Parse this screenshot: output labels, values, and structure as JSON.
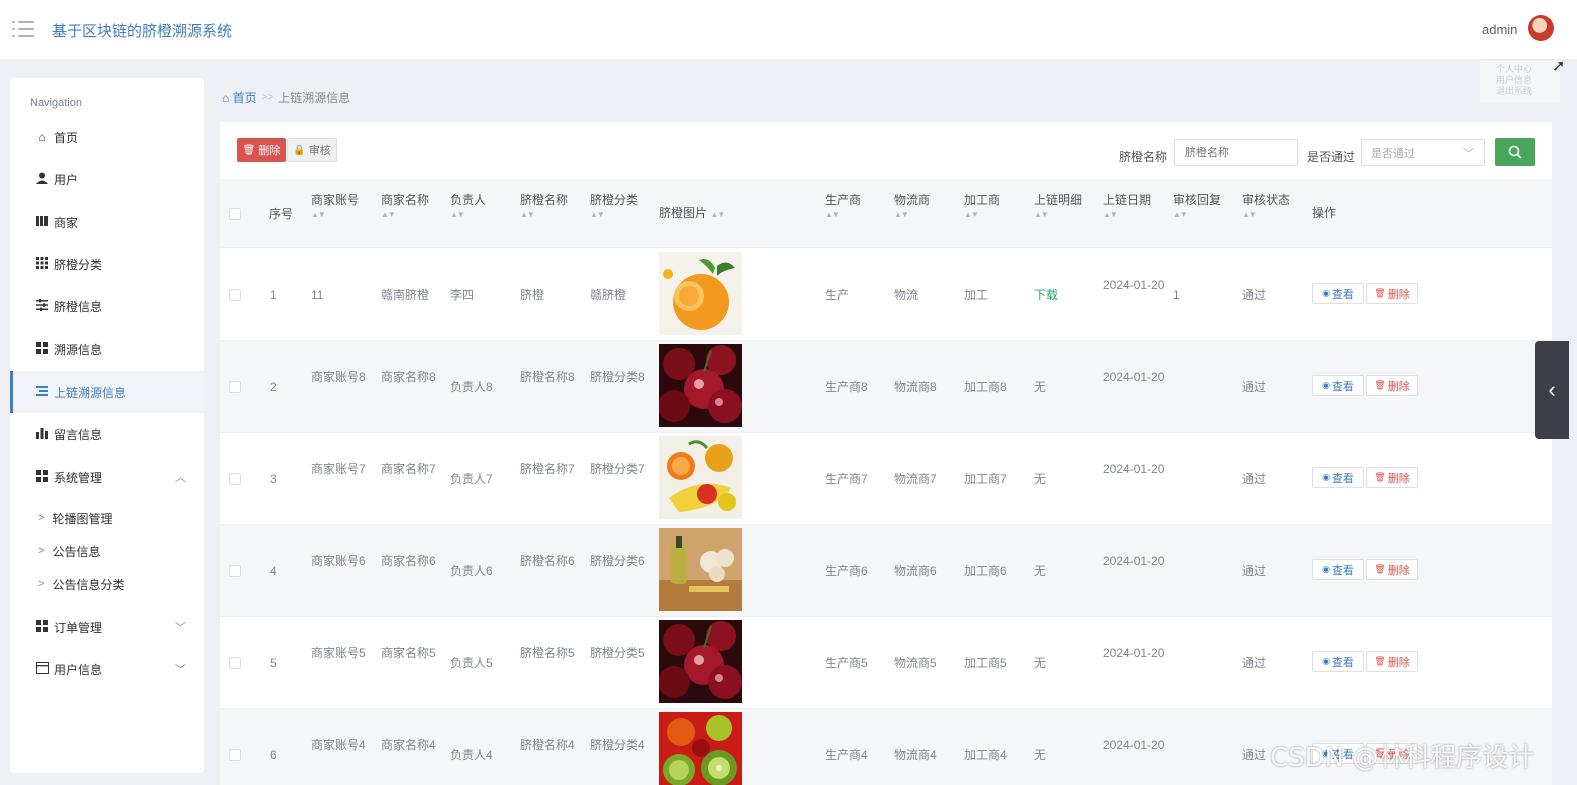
{
  "app": {
    "title": "基于区块链的脐橙溯源系统",
    "user": "admin",
    "ghost_menu": [
      "个人中心",
      "用户信息",
      "退出系统"
    ]
  },
  "sidebar": {
    "caption": "Navigation",
    "items": [
      {
        "label": "首页",
        "icon": "home-icon"
      },
      {
        "label": "用户",
        "icon": "user-icon"
      },
      {
        "label": "商家",
        "icon": "book-icon"
      },
      {
        "label": "脐橙分类",
        "icon": "grid-icon"
      },
      {
        "label": "脐橙信息",
        "icon": "sliders-icon"
      },
      {
        "label": "溯源信息",
        "icon": "tiles-icon"
      },
      {
        "label": "上链溯源信息",
        "icon": "list-icon",
        "active": true
      },
      {
        "label": "留言信息",
        "icon": "bar-chart-icon"
      },
      {
        "label": "系统管理",
        "icon": "tiles-icon",
        "expanded": true
      },
      {
        "label": "订单管理",
        "icon": "tiles-icon"
      },
      {
        "label": "用户信息",
        "icon": "card-icon"
      }
    ],
    "system_sub": [
      "轮播图管理",
      "公告信息",
      "公告信息分类"
    ]
  },
  "breadcrumb": {
    "home": "首页",
    "sep": ">>",
    "current": "上链溯源信息"
  },
  "toolbar": {
    "delete_label": "删除",
    "audit_label": "审核",
    "name_label": "脐橙名称",
    "name_placeholder": "脐橙名称",
    "pass_label": "是否通过",
    "pass_placeholder": "是否通过"
  },
  "table": {
    "headers": [
      "序号",
      "商家账号",
      "商家名称",
      "负责人",
      "脐橙名称",
      "脐橙分类",
      "脐橙图片",
      "生产商",
      "物流商",
      "加工商",
      "上链明细",
      "上链日期",
      "审核回复",
      "审核状态",
      "操作"
    ],
    "view_label": "查看",
    "delete_label": "删除",
    "rows": [
      {
        "no": "1",
        "account": "11",
        "shop": "赣南脐橙",
        "owner": "李四",
        "name": "脐橙",
        "category": "赣脐橙",
        "image": "orange",
        "producer": "生产",
        "logistics": "物流",
        "processor": "加工",
        "detail": "下载",
        "date": "2024-01-20",
        "reply": "1",
        "status": "通过"
      },
      {
        "no": "2",
        "account": "商家账号8",
        "shop": "商家名称8",
        "owner": "负责人8",
        "name": "脐橙名称8",
        "category": "脐橙分类8",
        "image": "cherries",
        "producer": "生产商8",
        "logistics": "物流商8",
        "processor": "加工商8",
        "detail": "无",
        "date": "2024-01-20",
        "reply": "",
        "status": "通过"
      },
      {
        "no": "3",
        "account": "商家账号7",
        "shop": "商家名称7",
        "owner": "负责人7",
        "name": "脐橙名称7",
        "category": "脐橙分类7",
        "image": "fruits",
        "producer": "生产商7",
        "logistics": "物流商7",
        "processor": "加工商7",
        "detail": "无",
        "date": "2024-01-20",
        "reply": "",
        "status": "通过"
      },
      {
        "no": "4",
        "account": "商家账号6",
        "shop": "商家名称6",
        "owner": "负责人6",
        "name": "脐橙名称6",
        "category": "脐橙分类6",
        "image": "oil",
        "producer": "生产商6",
        "logistics": "物流商6",
        "processor": "加工商6",
        "detail": "无",
        "date": "2024-01-20",
        "reply": "",
        "status": "通过"
      },
      {
        "no": "5",
        "account": "商家账号5",
        "shop": "商家名称5",
        "owner": "负责人5",
        "name": "脐橙名称5",
        "category": "脐橙分类5",
        "image": "cherries",
        "producer": "生产商5",
        "logistics": "物流商5",
        "processor": "加工商5",
        "detail": "无",
        "date": "2024-01-20",
        "reply": "",
        "status": "通过"
      },
      {
        "no": "6",
        "account": "商家账号4",
        "shop": "商家名称4",
        "owner": "负责人4",
        "name": "脐橙名称4",
        "category": "脐橙分类4",
        "image": "kiwi",
        "producer": "生产商4",
        "logistics": "物流商4",
        "processor": "加工商4",
        "detail": "无",
        "date": "2024-01-20",
        "reply": "",
        "status": "通过"
      }
    ]
  },
  "watermark": "CSDN @林科程序设计"
}
